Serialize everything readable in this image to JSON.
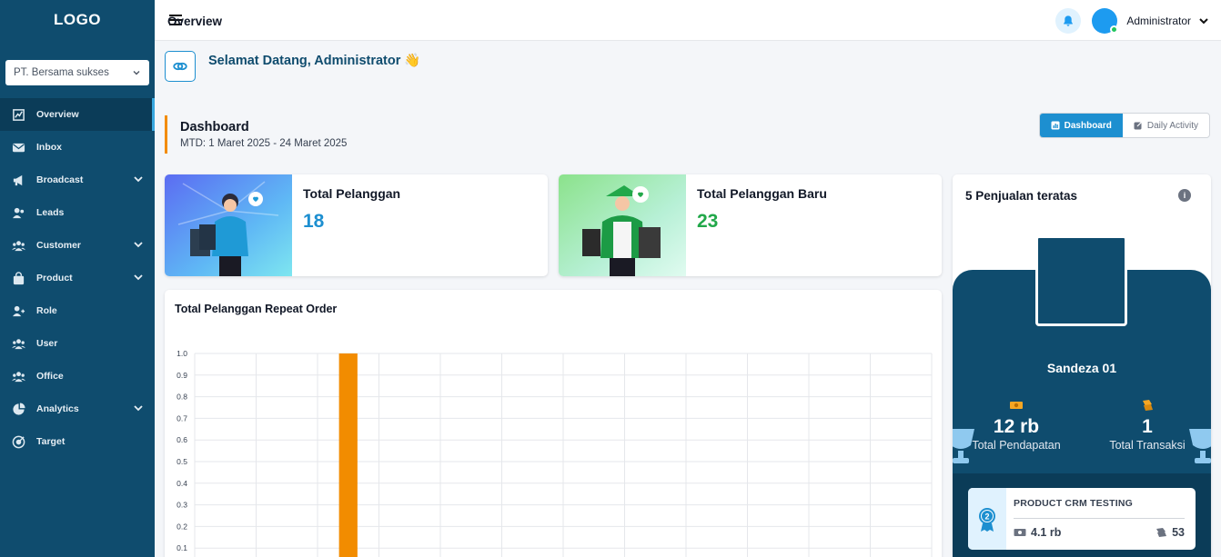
{
  "sidebar": {
    "logo": "LOGO",
    "company_select": "PT. Bersama sukses",
    "items": [
      {
        "label": "Overview",
        "icon": "chart-icon",
        "active": true,
        "expandable": false
      },
      {
        "label": "Inbox",
        "icon": "mail-icon",
        "active": false,
        "expandable": false
      },
      {
        "label": "Broadcast",
        "icon": "megaphone-icon",
        "active": false,
        "expandable": true
      },
      {
        "label": "Leads",
        "icon": "users-icon",
        "active": false,
        "expandable": false
      },
      {
        "label": "Customer",
        "icon": "group-icon",
        "active": false,
        "expandable": true
      },
      {
        "label": "Product",
        "icon": "bag-icon",
        "active": false,
        "expandable": true
      },
      {
        "label": "Role",
        "icon": "user-plus-icon",
        "active": false,
        "expandable": false
      },
      {
        "label": "User",
        "icon": "group-icon",
        "active": false,
        "expandable": false
      },
      {
        "label": "Office",
        "icon": "group-icon",
        "active": false,
        "expandable": false
      },
      {
        "label": "Analytics",
        "icon": "pie-icon",
        "active": false,
        "expandable": true
      },
      {
        "label": "Target",
        "icon": "target-icon",
        "active": false,
        "expandable": false
      }
    ]
  },
  "topbar": {
    "title": "Overview",
    "user_name": "Administrator"
  },
  "welcome": {
    "text": "Selamat Datang, Administrator 👋"
  },
  "dashboard": {
    "title": "Dashboard",
    "period": "MTD: 1 Maret 2025 - 24 Maret 2025",
    "tabs": [
      {
        "label": "Dashboard",
        "active": true
      },
      {
        "label": "Daily Activity",
        "active": false
      }
    ]
  },
  "stats": [
    {
      "label": "Total Pelanggan",
      "value": "18",
      "color": "#1d8fd0"
    },
    {
      "label": "Total Pelanggan Baru",
      "value": "23",
      "color": "#22a84a"
    }
  ],
  "chart_data": {
    "type": "bar",
    "title": "Total Pelanggan Repeat Order",
    "y_ticks": [
      "1.0",
      "0.9",
      "0.8",
      "0.7",
      "0.6",
      "0.5",
      "0.4",
      "0.3",
      "0.2",
      "0.1"
    ],
    "ylim": [
      0,
      1.0
    ],
    "grid": true,
    "bar_count_slots": 12,
    "values": [
      0,
      0,
      1.0,
      0,
      0,
      0,
      0,
      0,
      0,
      0,
      0,
      0
    ],
    "bar_color": "#f28c00"
  },
  "top_sales": {
    "title": "5 Penjualan teratas",
    "winner": {
      "name": "Sandeza 01",
      "revenue": "12 rb",
      "revenue_label": "Total Pendapatan",
      "transactions": "1",
      "transactions_label": "Total Transaksi"
    },
    "runner_up": {
      "rank": "2",
      "name": "PRODUCT CRM TESTING",
      "revenue": "4.1 rb",
      "transactions": "53"
    }
  },
  "colors": {
    "sidebar": "#0f4c6e",
    "accent": "#1d8fd0",
    "orange": "#f28c00",
    "green": "#22a84a"
  }
}
